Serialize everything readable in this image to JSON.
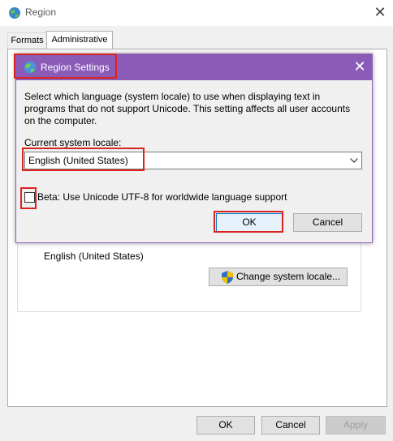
{
  "window": {
    "title": "Region",
    "close_glyph": "✕"
  },
  "tabs": [
    {
      "label": "Formats"
    },
    {
      "label": "Administrative"
    }
  ],
  "admin_panel": {
    "current_locale": "English (United States)",
    "change_locale_button": "Change system locale..."
  },
  "bottom_buttons": {
    "ok": "OK",
    "cancel": "Cancel",
    "apply": "Apply"
  },
  "dialog": {
    "title": "Region Settings",
    "close_glyph": "✕",
    "description": "Select which language (system locale) to use when displaying text in programs that do not support Unicode. This setting affects all user accounts on the computer.",
    "locale_label": "Current system locale:",
    "locale_value": "English (United States)",
    "beta_label": "Beta: Use Unicode UTF-8 for worldwide language support",
    "beta_checked": false,
    "ok": "OK",
    "cancel": "Cancel"
  },
  "colors": {
    "dialog_titlebar": "#8a5cb8",
    "highlight": "#d9231f",
    "button_face": "#e1e1e1",
    "window_bg": "#f0f0f0"
  },
  "icons": {
    "window_icon": "globe-icon",
    "dialog_icon": "globe-icon",
    "button_icon": "uac-shield-icon",
    "dropdown_icon": "chevron-down-icon"
  }
}
